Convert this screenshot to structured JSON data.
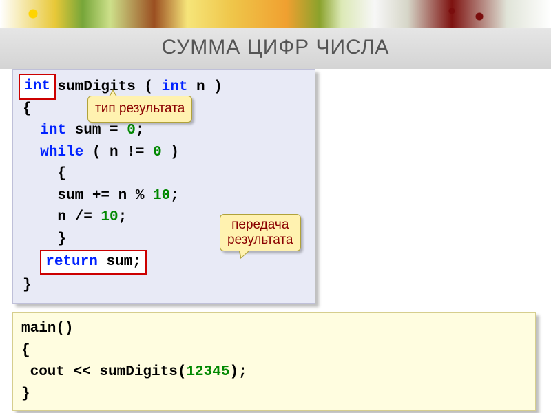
{
  "title": "СУММА ЦИФР ЧИСЛА",
  "int_label": "int",
  "callouts": {
    "result_type": "тип результата",
    "return_result_l1": "передача",
    "return_result_l2": "результата"
  },
  "code": {
    "l1_pre": "    sumDigits ( ",
    "l1_kw": "int",
    "l1_post": " n )",
    "l2": "{",
    "l3_indent": "  ",
    "l3_kw": "int",
    "l3_mid": " sum = ",
    "l3_num": "0",
    "l3_end": ";",
    "l4_indent": "  ",
    "l4_kw": "while",
    "l4_mid": " ( n != ",
    "l4_num": "0",
    "l4_end": " ) ",
    "l5": "    {",
    "l6_pre": "    sum += n % ",
    "l6_num": "10",
    "l6_end": ";",
    "l7_pre": "    n /= ",
    "l7_num": "10",
    "l7_end": ";",
    "l8": "    }",
    "l9_indent": "  ",
    "l9_kw": "return",
    "l9_post": " sum;",
    "l10": "}"
  },
  "main": {
    "l1": "main()",
    "l2": "{",
    "l3_pre": " cout << sumDigits(",
    "l3_num": "12345",
    "l3_post": "); ",
    "l4": "}"
  }
}
